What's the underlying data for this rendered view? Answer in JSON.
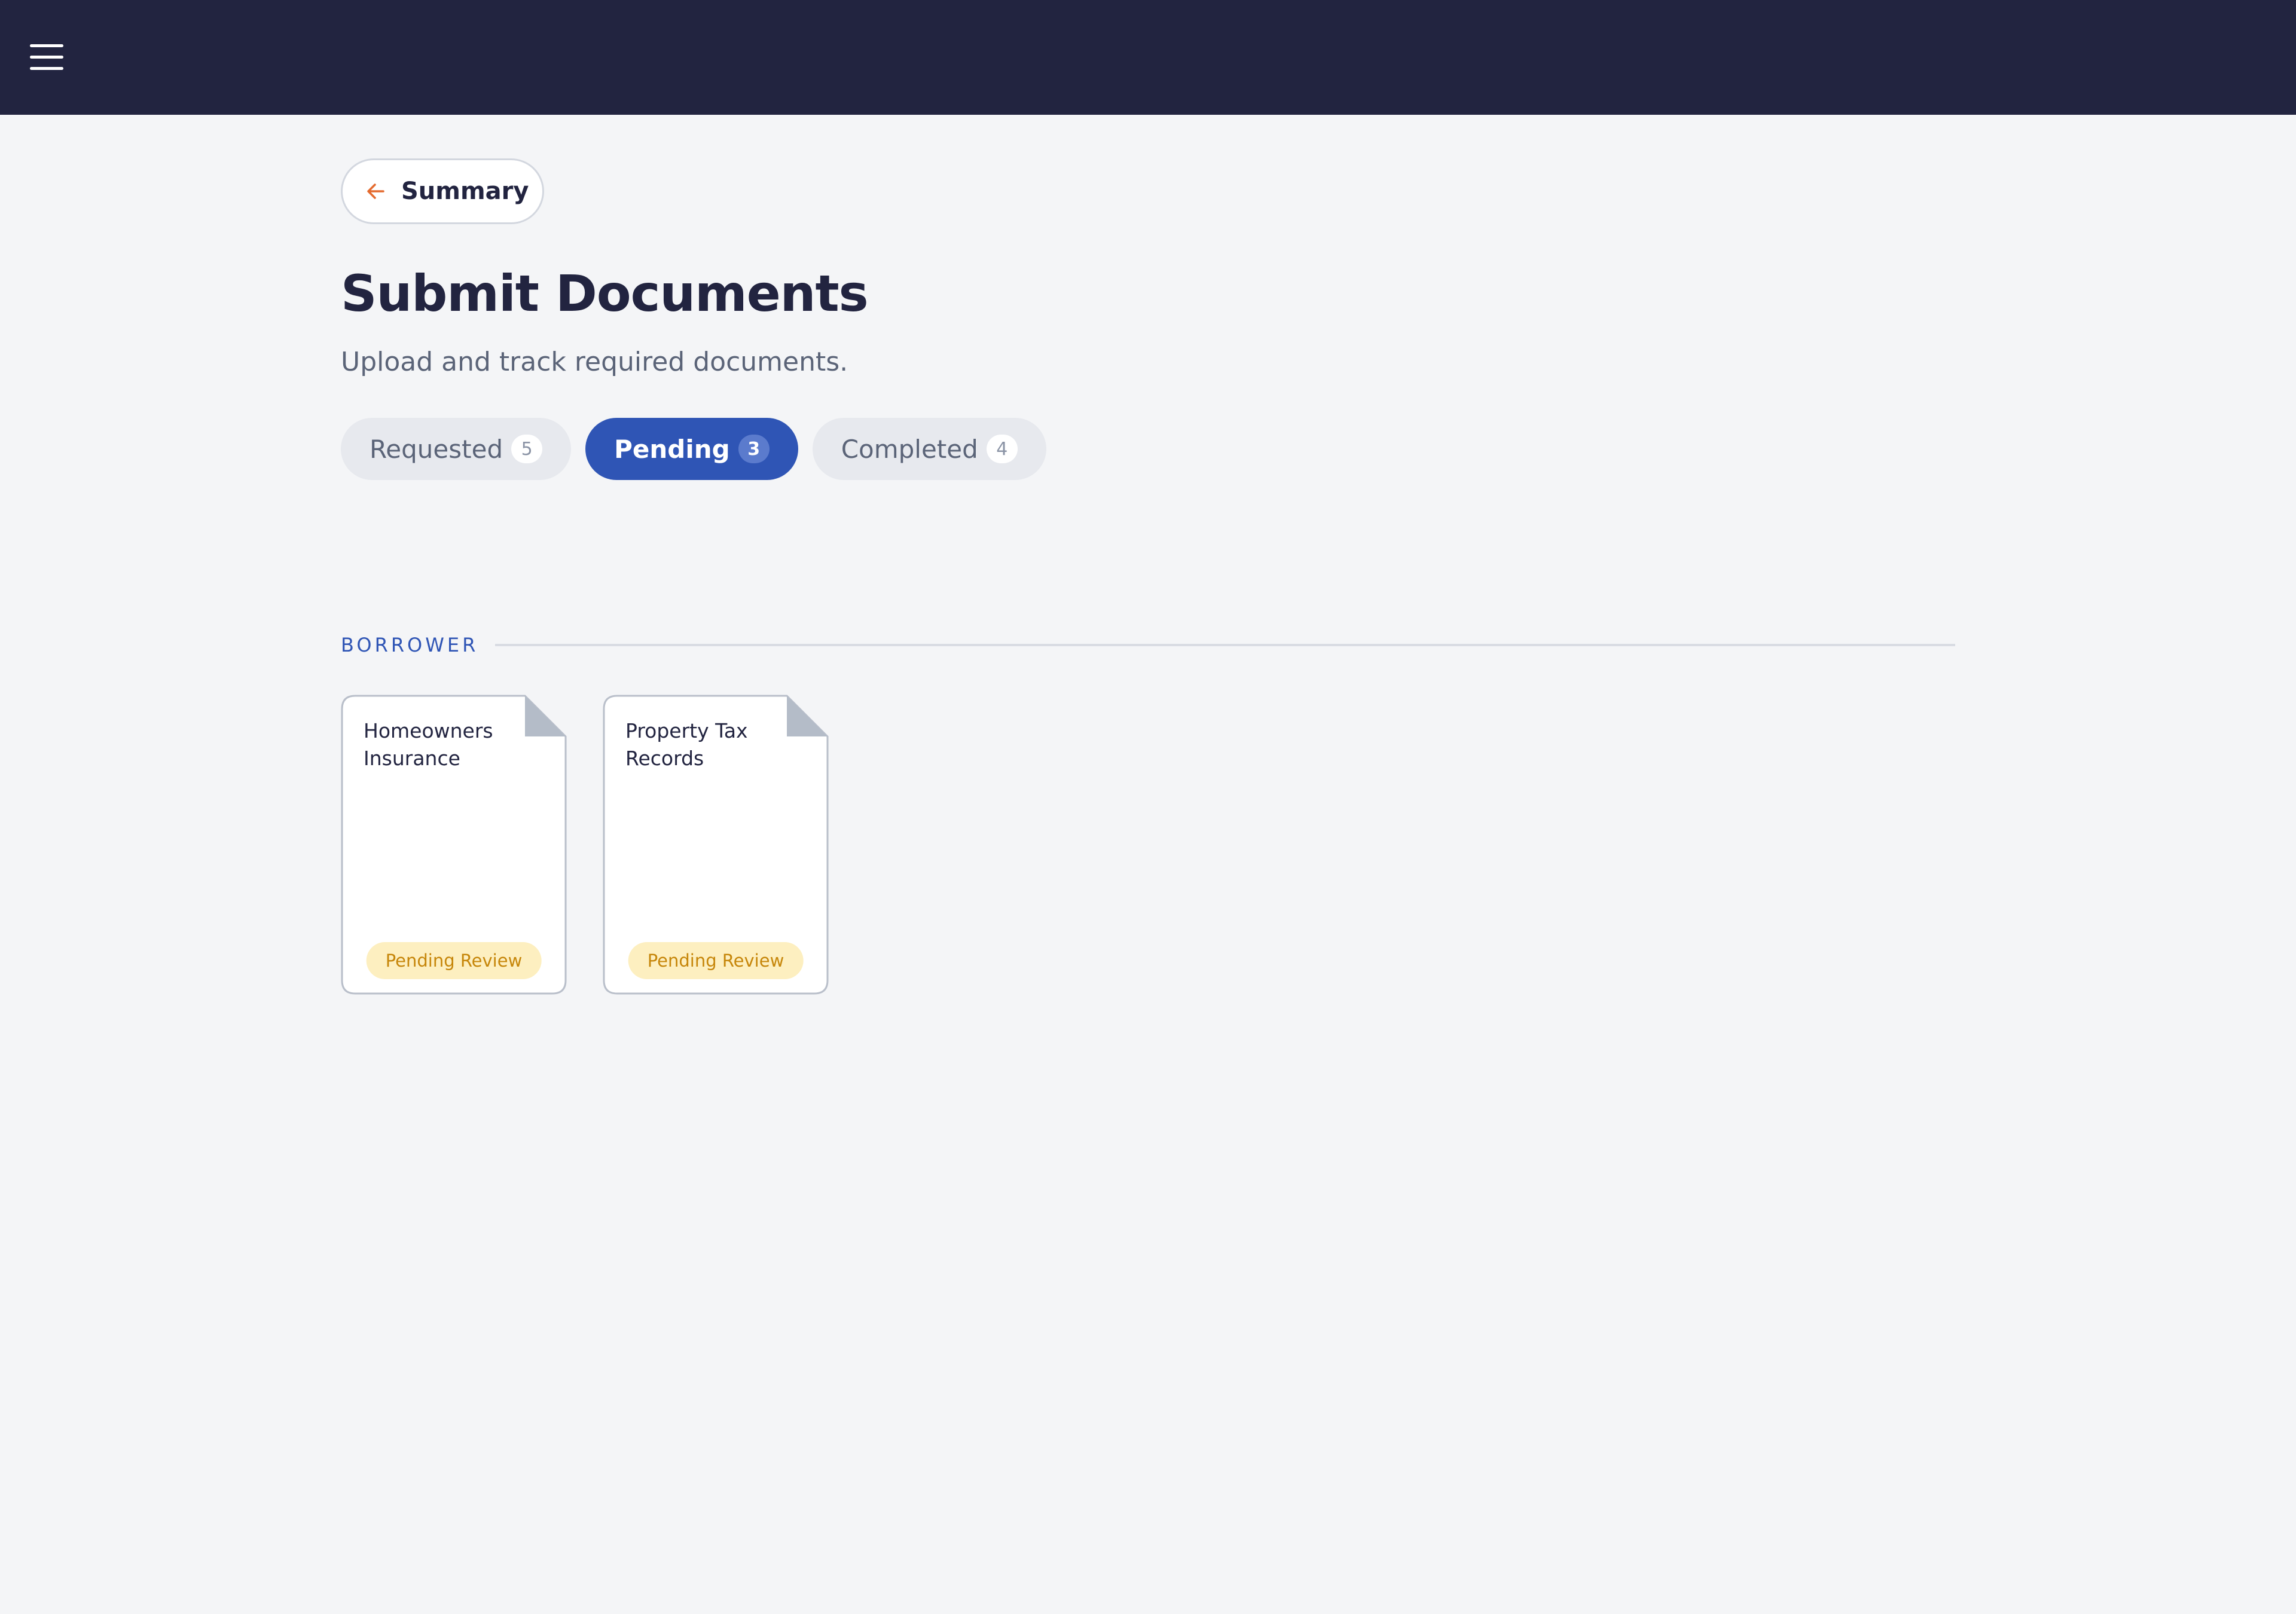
{
  "header": {
    "menu_icon": "hamburger-menu-icon",
    "background_color": "#222440"
  },
  "back_button": {
    "label": "Summary",
    "icon": "arrow-left-icon",
    "icon_color": "#e46a2e"
  },
  "page": {
    "title": "Submit Documents",
    "subtitle": "Upload and track required documents."
  },
  "tabs": [
    {
      "label": "Requested",
      "count": "5",
      "active": false
    },
    {
      "label": "Pending",
      "count": "3",
      "active": true
    },
    {
      "label": "Completed",
      "count": "4",
      "active": false
    }
  ],
  "section": {
    "label": "BORROWER"
  },
  "documents": [
    {
      "title": "Homeowners Insurance",
      "status": "Pending Review",
      "icon": "document-icon"
    },
    {
      "title": "Property Tax Records",
      "status": "Pending Review",
      "icon": "document-icon"
    }
  ],
  "colors": {
    "accent": "#2f55b5",
    "page_background": "#f4f5f7",
    "pending_badge_bg": "#fdefc0",
    "pending_badge_text": "#c6860a"
  }
}
